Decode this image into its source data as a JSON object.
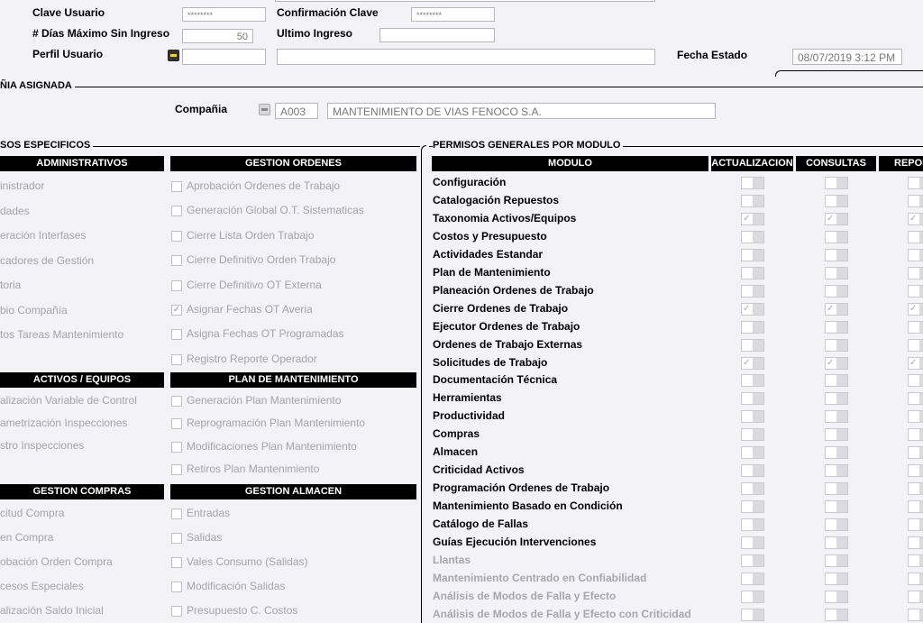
{
  "user_form": {
    "clave_usuario_label": "Clave Usuario",
    "clave_usuario_value": "********",
    "confirmacion_clave_label": "Confirmación Clave",
    "confirmacion_clave_value": "********",
    "dias_maximo_label": "# Días Máximo Sin Ingreso",
    "dias_maximo_value": "50",
    "ultimo_ingreso_label": "Ultimo Ingreso",
    "ultimo_ingreso_value": "",
    "perfil_usuario_label": "Perfil Usuario",
    "perfil_usuario_value": "",
    "perfil_desc_value": "",
    "fecha_estado_label": "Fecha Estado",
    "fecha_estado_value": "08/07/2019 3:12 PM"
  },
  "compania": {
    "section_title": "ÑIA ASIGNADA",
    "label": "Compañia",
    "code": "A003",
    "name": "MANTENIMIENTO DE VIAS FENOCO S.A."
  },
  "permisos_especificos": {
    "section_title": "SOS ESPECIFICOS",
    "groups": {
      "administrativos": {
        "header": "ADMINISTRATIVOS",
        "items": [
          "inistrador",
          "dades",
          "eración Interfases",
          "cadores de Gestión",
          "toria",
          "bio Compañía",
          "tos Tareas Mantenimiento"
        ]
      },
      "gestion_ordenes": {
        "header": "GESTION ORDENES",
        "items": [
          "Aprobación Ordenes de Trabajo",
          "Generación Global O.T. Sistematicas",
          "Cierre Lista Orden Trabajo",
          "Cierre Definitivo Orden Trabajo",
          "Cierre Definitivo OT Externa",
          "Asignar Fechas OT Averia",
          "Asigna Fechas OT Programadas",
          "Registro Reporte Operador"
        ],
        "checked": [
          false,
          false,
          false,
          false,
          false,
          true,
          false,
          false
        ]
      },
      "activos_equipos": {
        "header": "ACTIVOS / EQUIPOS",
        "items": [
          "alización Variable de Control",
          "ametrización Inspecciones",
          "stro Inspecciones"
        ]
      },
      "plan_mantenimiento": {
        "header": "PLAN DE MANTENIMIENTO",
        "items": [
          "Generación  Plan Mantenimiento",
          "Reprogramación Plan Mantenimiento",
          "Modificaciones Plan Mantenimiento",
          "Retiros Plan Mantenimiento"
        ]
      },
      "gestion_compras": {
        "header": "GESTION COMPRAS",
        "items": [
          "citud Compra",
          "en Compra",
          "obación Orden Compra",
          "cesos Especiales",
          "alización Saldo Inicial"
        ]
      },
      "gestion_almacen": {
        "header": "GESTION ALMACEN",
        "items": [
          "Entradas",
          "Salidas",
          "Vales Consumo (Salidas)",
          "Modificación Salidas",
          "Presupuesto C. Costos"
        ]
      }
    }
  },
  "permisos_generales": {
    "section_title": "PERMISOS GENERALES POR MODULO",
    "headers": {
      "modulo": "MODULO",
      "actualizacion": "ACTUALIZACION",
      "consultas": "CONSULTAS",
      "reportes": "REPOR"
    },
    "rows": [
      {
        "name": "Configuración",
        "a": false,
        "c": false,
        "r": false,
        "enabled": true
      },
      {
        "name": "Catalogación Repuestos",
        "a": false,
        "c": false,
        "r": false,
        "enabled": true
      },
      {
        "name": "Taxonomia Activos/Equipos",
        "a": true,
        "c": true,
        "r": true,
        "enabled": true
      },
      {
        "name": "Costos y Presupuesto",
        "a": false,
        "c": false,
        "r": false,
        "enabled": true
      },
      {
        "name": "Actividades Estandar",
        "a": false,
        "c": false,
        "r": false,
        "enabled": true
      },
      {
        "name": "Plan de Mantenimiento",
        "a": false,
        "c": false,
        "r": false,
        "enabled": true
      },
      {
        "name": "Planeación Ordenes de Trabajo",
        "a": false,
        "c": false,
        "r": false,
        "enabled": true
      },
      {
        "name": "Cierre Ordenes de Trabajo",
        "a": true,
        "c": true,
        "r": true,
        "enabled": true
      },
      {
        "name": "Ejecutor Ordenes de Trabajo",
        "a": false,
        "c": false,
        "r": false,
        "enabled": true
      },
      {
        "name": "Ordenes de Trabajo Externas",
        "a": false,
        "c": false,
        "r": false,
        "enabled": true
      },
      {
        "name": "Solicitudes de Trabajo",
        "a": true,
        "c": true,
        "r": true,
        "enabled": true
      },
      {
        "name": "Documentación Técnica",
        "a": false,
        "c": false,
        "r": false,
        "enabled": true
      },
      {
        "name": "Herramientas",
        "a": false,
        "c": false,
        "r": false,
        "enabled": true
      },
      {
        "name": "Productividad",
        "a": false,
        "c": false,
        "r": false,
        "enabled": true
      },
      {
        "name": "Compras",
        "a": false,
        "c": false,
        "r": false,
        "enabled": true
      },
      {
        "name": "Almacen",
        "a": false,
        "c": false,
        "r": false,
        "enabled": true
      },
      {
        "name": "Criticidad Activos",
        "a": false,
        "c": false,
        "r": false,
        "enabled": true
      },
      {
        "name": "Programación Ordenes de Trabajo",
        "a": false,
        "c": false,
        "r": false,
        "enabled": true
      },
      {
        "name": "Mantenimiento Basado en Condición",
        "a": false,
        "c": false,
        "r": false,
        "enabled": true
      },
      {
        "name": "Catálogo de Fallas",
        "a": false,
        "c": false,
        "r": false,
        "enabled": true
      },
      {
        "name": "Guías Ejecución Intervenciones",
        "a": false,
        "c": false,
        "r": false,
        "enabled": true
      },
      {
        "name": "Llantas",
        "a": false,
        "c": false,
        "r": false,
        "enabled": false
      },
      {
        "name": "Mantenimiento Centrado en Confiabilidad",
        "a": false,
        "c": false,
        "r": false,
        "enabled": false
      },
      {
        "name": "Análisis de Modos de Falla y Efecto",
        "a": false,
        "c": false,
        "r": false,
        "enabled": false
      },
      {
        "name": "Análisis de Modos de Falla y Efecto con Criticidad",
        "a": false,
        "c": false,
        "r": false,
        "enabled": false
      }
    ]
  }
}
